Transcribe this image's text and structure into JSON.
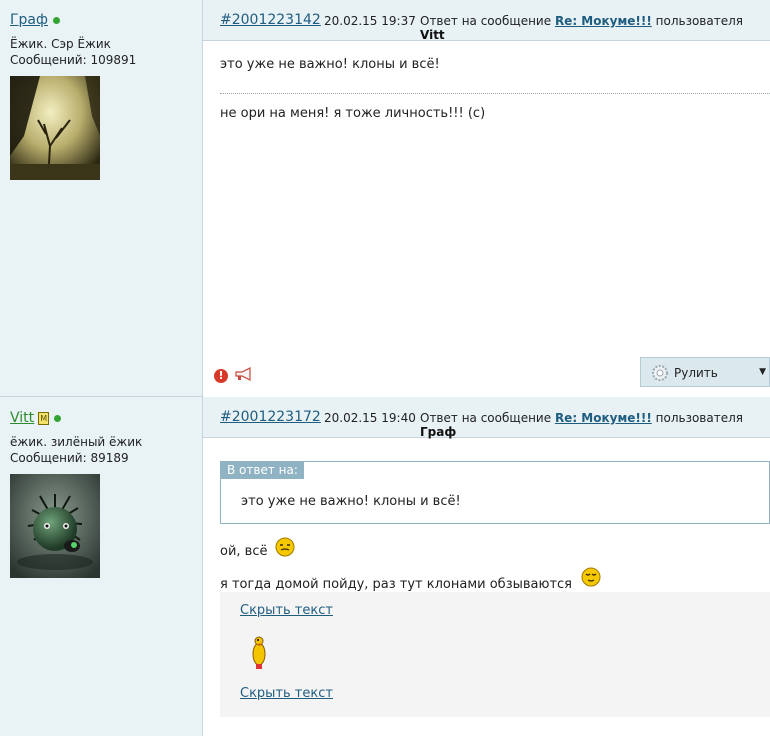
{
  "posts": [
    {
      "author": "Граф",
      "status": "Ёжик. Сэр Ёжик",
      "post_count": "Сообщений: 109891",
      "post_id": "#2001223142",
      "date": "20.02.15 19:37",
      "reply_prefix": "Ответ на сообщение",
      "reply_title": "Re: Мокуме!!!",
      "reply_user_prefix": "пользователя",
      "reply_user": "Vitt",
      "lines": [
        "это уже не важно! клоны и всё!",
        "не ори на меня! я тоже личность!!! (с)"
      ],
      "action_button": "Рулить"
    },
    {
      "author": "Vitt",
      "status": "ёжик. зилёный ёжик",
      "post_count": "Сообщений: 89189",
      "post_id": "#2001223172",
      "date": "20.02.15 19:40",
      "reply_prefix": "Ответ на сообщение",
      "reply_title": "Re: Мокуме!!!",
      "reply_user_prefix": "пользователя",
      "reply_user": "Граф",
      "quote_header": "В ответ на:",
      "quote_text": "это уже не важно! клоны и всё!",
      "lines": [
        "ой, всё",
        "я тогда домой пойду, раз тут клонами обзываются"
      ],
      "spoiler_toggle": "Скрыть текст"
    }
  ],
  "colors": {
    "link": "#1f5d80",
    "online": "#31a531",
    "header_bg": "#e8f1f4",
    "sidebar_bg": "#e9f2f5"
  }
}
